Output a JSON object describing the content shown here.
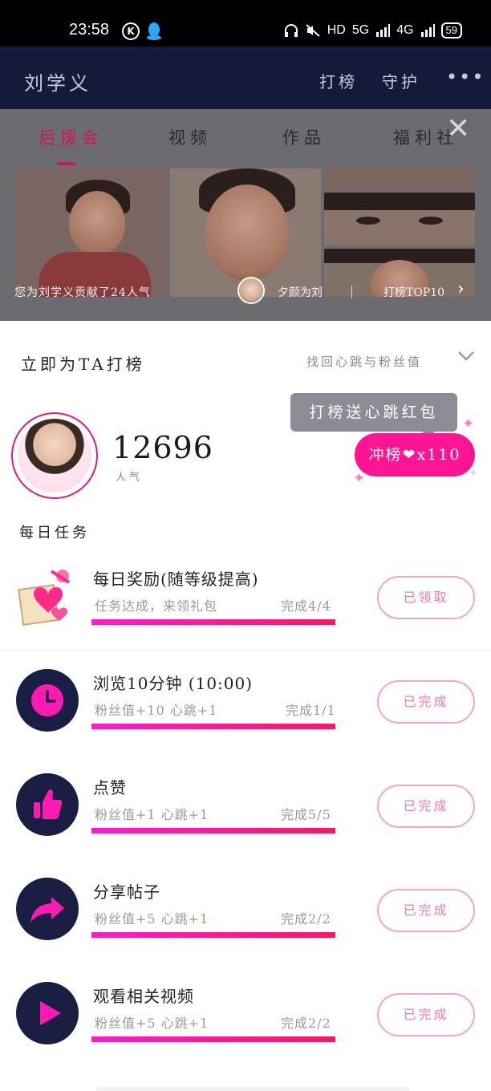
{
  "status_bar": {
    "time": "23:58",
    "k_label": "K",
    "indicators": "HD",
    "network1": "5G",
    "network2": "4G",
    "battery": "59"
  },
  "header": {
    "title": "刘学义",
    "actions": [
      "打榜",
      "守护"
    ],
    "more": "•••"
  },
  "tabs": [
    {
      "label": "后援会",
      "active": true
    },
    {
      "label": "视频",
      "active": false
    },
    {
      "label": "作品",
      "active": false
    },
    {
      "label": "福利社",
      "active": false
    }
  ],
  "overlay": {
    "fan_contribution": "您为刘学义贡献了24人气",
    "user_message": "夕颜为刘",
    "rank_link": "打榜TOP10"
  },
  "sheet": {
    "title": "立即为TA打榜",
    "find_link": "找回心跳与粉丝值",
    "popularity_value": "12696",
    "popularity_label": "人气",
    "tooltip": "打榜送心跳红包",
    "vote_button": "冲榜❤x110",
    "tasks_title": "每日任务"
  },
  "tasks": [
    {
      "name": "每日奖励(随等级提高)",
      "reward": "任务达成，来领礼包",
      "progress": "完成4/4",
      "status": "已领取",
      "progress_fraction": 1.0
    },
    {
      "name": "浏览10分钟 (10:00)",
      "reward": "粉丝值+10 心跳+1",
      "progress": "完成1/1",
      "status": "已完成",
      "progress_fraction": 1.0
    },
    {
      "name": "点赞",
      "reward": "粉丝值+1 心跳+1",
      "progress": "完成5/5",
      "status": "已完成",
      "progress_fraction": 1.0
    },
    {
      "name": "分享帖子",
      "reward": "粉丝值+5 心跳+1",
      "progress": "完成2/2",
      "status": "已完成",
      "progress_fraction": 1.0
    },
    {
      "name": "观看相关视频",
      "reward": "粉丝值+5 心跳+1",
      "progress": "完成2/2",
      "status": "已完成",
      "progress_fraction": 1.0
    }
  ],
  "colors": {
    "accent": "#ff1493",
    "navy": "#1b1e43",
    "header_bg": "#141a3a"
  },
  "icons": [
    "clock-icon",
    "thumbs-up-icon",
    "share-icon",
    "play-icon",
    "gift-icon",
    "close-icon",
    "chevron-right-icon",
    "chevron-down-icon",
    "more-icon"
  ]
}
